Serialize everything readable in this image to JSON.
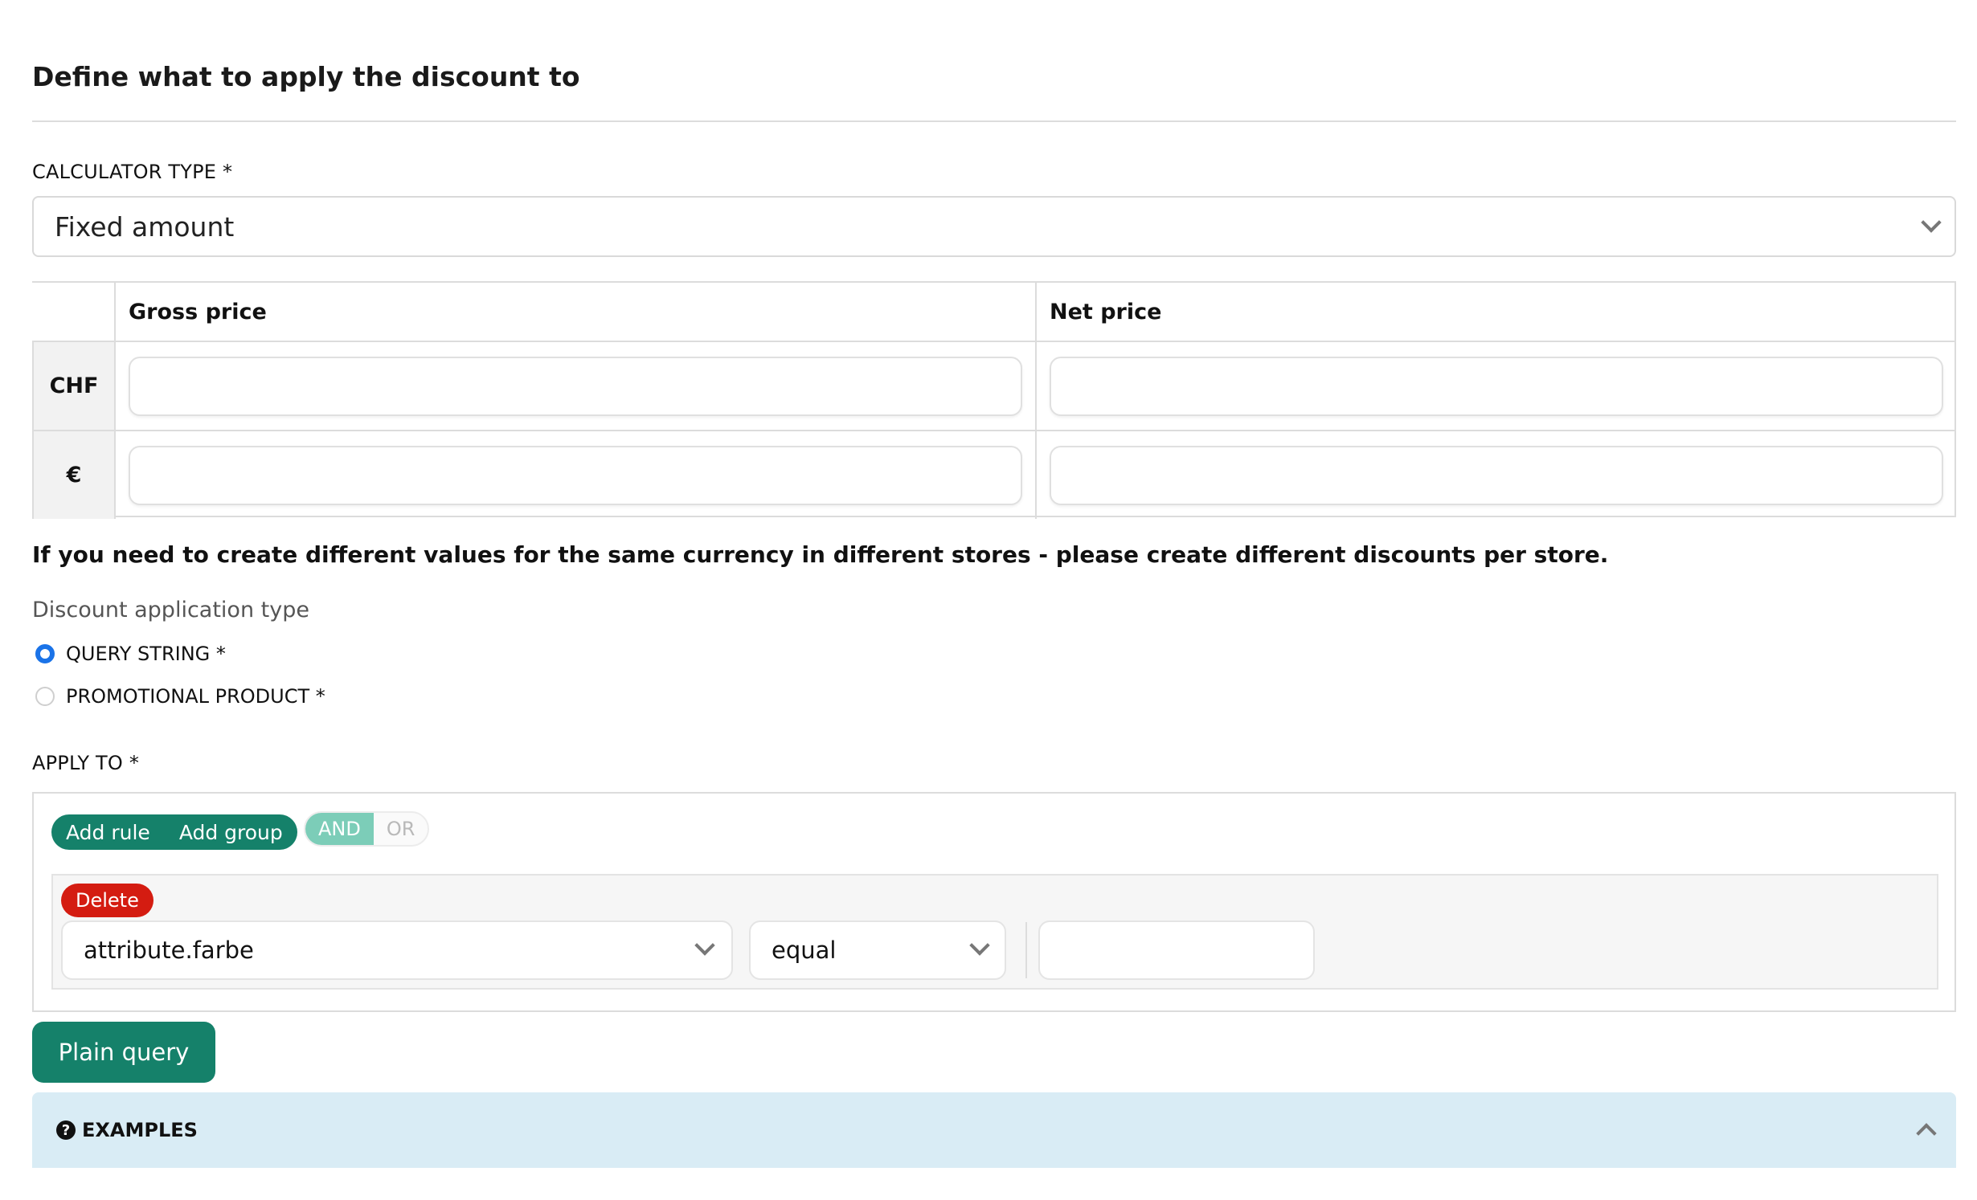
{
  "section": {
    "title": "Define what to apply the discount to"
  },
  "calculator": {
    "label": "CALCULATOR TYPE *",
    "selected": "Fixed amount",
    "icon": "chevron-down-icon"
  },
  "price_table": {
    "columns": [
      "Gross price",
      "Net price"
    ],
    "rows": [
      {
        "currency": "CHF",
        "gross": "",
        "net": ""
      },
      {
        "currency": "€",
        "gross": "",
        "net": ""
      }
    ]
  },
  "notice": "If you need to create different values for the same currency in different stores - please create different discounts per store.",
  "application_type": {
    "label": "Discount application type",
    "options": [
      {
        "label": "QUERY STRING *",
        "checked": true
      },
      {
        "label": "PROMOTIONAL PRODUCT *",
        "checked": false
      }
    ]
  },
  "apply_to": {
    "label": "APPLY TO *",
    "add_rule": "Add rule",
    "add_group": "Add group",
    "and_label": "AND",
    "or_label": "OR",
    "active_condition": "AND",
    "rule": {
      "delete_label": "Delete",
      "field": "attribute.farbe",
      "operator": "equal",
      "value": ""
    }
  },
  "plain_query_label": "Plain query",
  "examples": {
    "label": "EXAMPLES",
    "icon": "question-circle-icon",
    "toggle_icon": "chevron-up-icon"
  },
  "colors": {
    "primary": "#15816a",
    "toggle_active": "#7ccdb8",
    "danger": "#d41c11",
    "radio_checked": "#1a73e8",
    "examples_bg": "#d9ecf5"
  }
}
